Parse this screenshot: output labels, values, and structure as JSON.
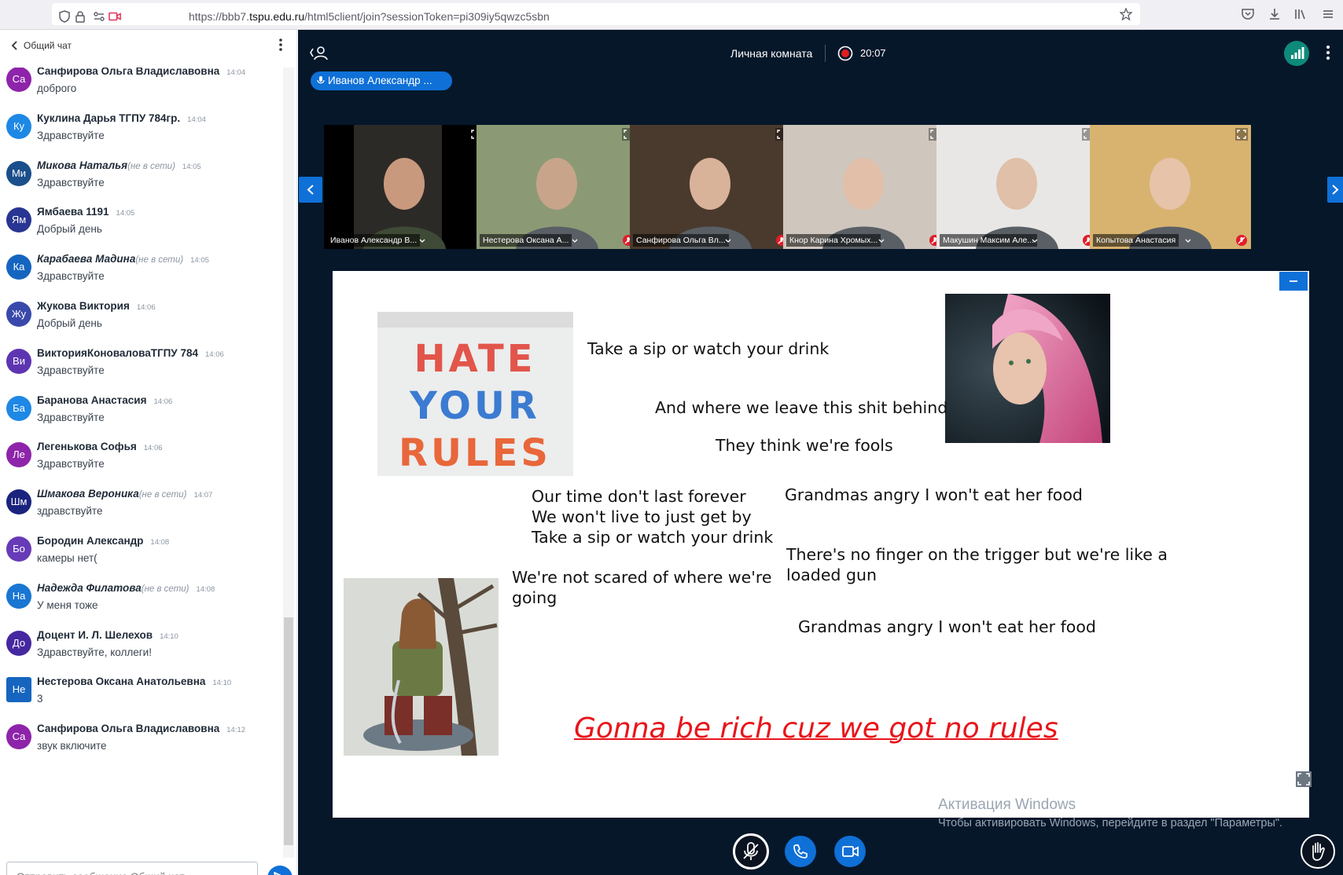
{
  "browser": {
    "url_prefix": "https://bbb7.",
    "url_host": "tspu.edu.ru",
    "url_path": "/html5client/join?sessionToken=pi309iy5qwzc5sbn"
  },
  "chat": {
    "title": "Общий чат",
    "input_placeholder": "Отправить сообщение Общий чат",
    "messages": [
      {
        "initials": "Са",
        "color": "#8e24aa",
        "name": "Санфирова Ольга Владиславовна",
        "offline_label": "",
        "time": "14:04",
        "text": "доброго"
      },
      {
        "initials": "Ку",
        "color": "#1e88e5",
        "name": "Куклина Дарья ТГПУ 784гр.",
        "offline_label": "",
        "time": "14:04",
        "text": "Здравствуйте"
      },
      {
        "initials": "Ми",
        "color": "#1a4f8b",
        "name": "Микова Наталья",
        "offline_label": "(не в сети)",
        "time": "14:05",
        "text": "Здравствуйте"
      },
      {
        "initials": "Ям",
        "color": "#283593",
        "name": "Ямбаева 1191",
        "offline_label": "",
        "time": "14:05",
        "text": "Добрый день"
      },
      {
        "initials": "Ка",
        "color": "#1565c0",
        "name": "Карабаева Мадина",
        "offline_label": "(не в сети)",
        "time": "14:05",
        "text": "Здравствуйте"
      },
      {
        "initials": "Жу",
        "color": "#3949ab",
        "name": "Жукова Виктория",
        "offline_label": "",
        "time": "14:06",
        "text": "Добрый день"
      },
      {
        "initials": "Ви",
        "color": "#5e35b1",
        "name": "ВикторияКоноваловаТГПУ 784",
        "offline_label": "",
        "time": "14:06",
        "text": "Здравствуйте"
      },
      {
        "initials": "Ба",
        "color": "#1e88e5",
        "name": "Баранова Анастасия",
        "offline_label": "",
        "time": "14:06",
        "text": "Здравствуйте"
      },
      {
        "initials": "Ле",
        "color": "#8e24aa",
        "name": "Легенькова Софья",
        "offline_label": "",
        "time": "14:06",
        "text": "Здравствуйте"
      },
      {
        "initials": "Шм",
        "color": "#1a237e",
        "name": "Шмакова Вероника",
        "offline_label": "(не в сети)",
        "time": "14:07",
        "text": "здравствуйте"
      },
      {
        "initials": "Бо",
        "color": "#673ab7",
        "name": "Бородин Александр",
        "offline_label": "",
        "time": "14:08",
        "text": "камеры нет("
      },
      {
        "initials": "На",
        "color": "#1976d2",
        "name": "Надежда Филатова",
        "offline_label": "(не в сети)",
        "time": "14:08",
        "text": "У меня тоже"
      },
      {
        "initials": "До",
        "color": "#4527a0",
        "name": "Доцент И. Л. Шелехов",
        "offline_label": "",
        "time": "14:10",
        "text": "Здравствуйте, коллеги!"
      },
      {
        "initials": "Не",
        "color": "#1565c0",
        "name": "Нестерова Оксана Анатольевна",
        "offline_label": "",
        "time": "14:10",
        "text": "3"
      },
      {
        "initials": "Са",
        "color": "#8e24aa",
        "name": "Санфирова Ольга Владиславовна",
        "offline_label": "",
        "time": "14:12",
        "text": "звук включите"
      }
    ]
  },
  "meeting": {
    "title": "Личная комната",
    "recording_time": "20:07",
    "talking_indicator": "Иванов Александр ..."
  },
  "videos": [
    {
      "name": "Иванов Александр В...",
      "active": true,
      "muted": false,
      "bg": "#2c2a26",
      "skin": "#c9997e"
    },
    {
      "name": "Нестерова Оксана А...",
      "active": false,
      "muted": true,
      "bg": "#8b9a75",
      "skin": "#c8a48a"
    },
    {
      "name": "Санфирова Ольга Вл...",
      "active": false,
      "muted": true,
      "bg": "#4a3a2e",
      "skin": "#d9b29a"
    },
    {
      "name": "Кнор Карина Хромых...",
      "active": false,
      "muted": true,
      "bg": "#cfc6bd",
      "skin": "#e2bfa8"
    },
    {
      "name": "Макушин Максим Але...",
      "active": false,
      "muted": true,
      "bg": "#e9e7e6",
      "skin": "#e0c0a8"
    },
    {
      "name": "Копытова Анастасия",
      "active": false,
      "muted": true,
      "bg": "#d8b370",
      "skin": "#e6c3a9"
    }
  ],
  "slide": {
    "image_text": {
      "line1": "HATE",
      "line2": "YOUR",
      "line3": "RULES"
    },
    "lines": {
      "l1": "Take a sip or watch your drink",
      "l2": "And where we leave this shit behind",
      "l3": "They think we're fools",
      "l4": "Our time don't last forever",
      "l5": "We won't live to just get by",
      "l6": "Take a sip or watch your drink",
      "l7": "Grandmas angry I won't eat her food",
      "l8": "There's no finger on the trigger but we're like a",
      "l9": "loaded gun",
      "l10": "We're not scared of where we're",
      "l11": "going",
      "l12": "Grandmas angry I won't eat her food"
    },
    "highlight": "Gonna be rich cuz we got no rules"
  },
  "watermark": {
    "line1": "Активация Windows",
    "line2": "Чтобы активировать Windows, перейдите в раздел \"Параметры\"."
  },
  "colors": {
    "accent": "#0f70d7",
    "stage_bg": "#06172a",
    "highlight_red": "#e8151b"
  }
}
